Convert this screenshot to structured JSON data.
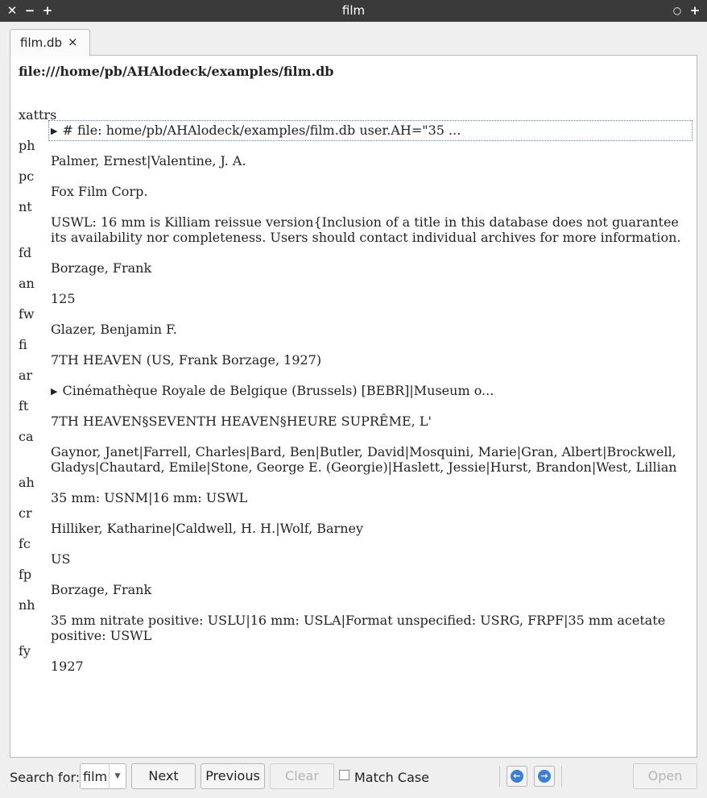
{
  "window": {
    "title": "film",
    "close_glyph": "✕",
    "min_glyph": "−",
    "max_glyph": "+",
    "menu_glyph": "○",
    "pin_glyph": "+"
  },
  "tab": {
    "label": "film.db",
    "close_glyph": "×"
  },
  "document": {
    "path": "file:///home/pb/AHAlodeck/examples/film.db",
    "rows": [
      {
        "key": "xattrs",
        "value": "# file: home/pb/AHAlodeck/examples/film.db user.AH=\"35 ...",
        "expandable": true
      },
      {
        "key": "ph",
        "value": "Palmer, Ernest|Valentine, J. A."
      },
      {
        "key": "pc",
        "value": "Fox Film Corp."
      },
      {
        "key": "nt",
        "value": "USWL: 16 mm is Killiam reissue version{Inclusion of a title in this database does not guarantee its availability nor completeness. Users should contact individual archives for more information."
      },
      {
        "key": "fd",
        "value": "Borzage, Frank"
      },
      {
        "key": "an",
        "value": "125"
      },
      {
        "key": "fw",
        "value": "Glazer, Benjamin F."
      },
      {
        "key": "fi",
        "value": "7TH HEAVEN (US, Frank Borzage, 1927)"
      },
      {
        "key": "ar",
        "value": "Cinémathèque Royale de Belgique (Brussels) [BEBR]|Museum o...",
        "expandable": true
      },
      {
        "key": "ft",
        "value": "7TH HEAVEN§SEVENTH HEAVEN§HEURE SUPRÊME, L'"
      },
      {
        "key": "ca",
        "value": "Gaynor, Janet|Farrell, Charles|Bard, Ben|Butler, David|Mosquini, Marie|Gran, Albert|Brockwell, Gladys|Chautard, Emile|Stone, George E. (Georgie)|Haslett, Jessie|Hurst, Brandon|West, Lillian"
      },
      {
        "key": "ah",
        "value": "35 mm: USNM|16 mm: USWL"
      },
      {
        "key": "cr",
        "value": "Hilliker, Katharine|Caldwell, H. H.|Wolf, Barney"
      },
      {
        "key": "fc",
        "value": "US"
      },
      {
        "key": "fp",
        "value": "Borzage, Frank"
      },
      {
        "key": "nh",
        "value": "35 mm nitrate positive: USLU|16 mm: USLA|Format unspecified: USRG, FRPF|35 mm acetate positive: USWL"
      },
      {
        "key": "fy",
        "value": "1927"
      }
    ]
  },
  "search": {
    "label": "Search for:",
    "value": "film",
    "next_label": "Next",
    "previous_label": "Previous",
    "clear_label": "Clear",
    "match_case_label": "Match Case",
    "open_label": "Open"
  },
  "icons": {
    "expand": "triangle-right-icon",
    "back": "back-arrow-icon",
    "forward": "forward-arrow-icon",
    "accent": "#3b7fd6"
  }
}
